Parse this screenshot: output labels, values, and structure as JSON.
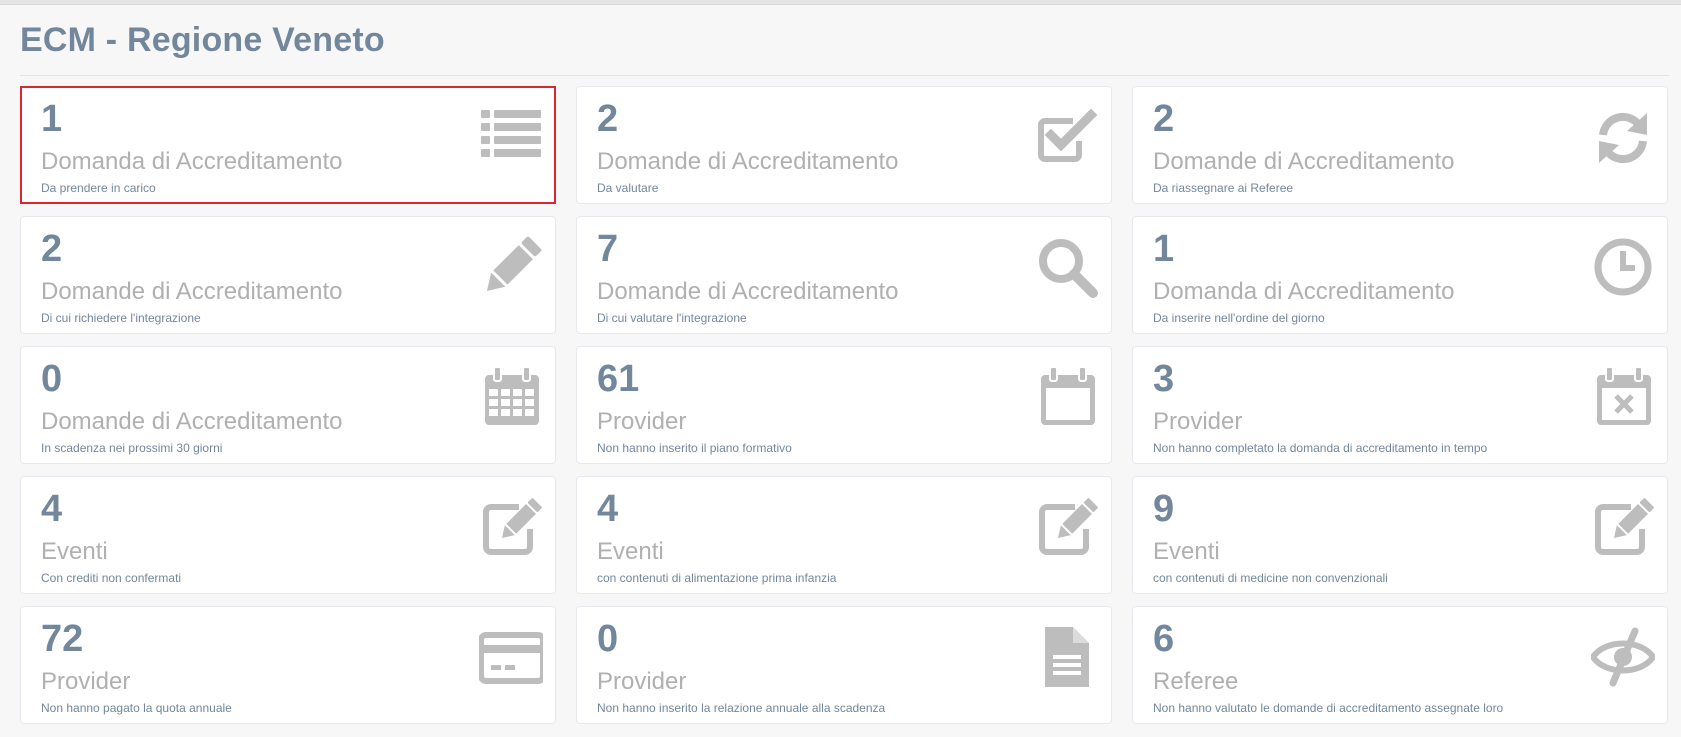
{
  "header": {
    "title": "ECM - Regione Veneto"
  },
  "colors": {
    "accent": "#73879c",
    "label": "#b0b0b0",
    "icon": "#bdbdbd",
    "selected_border": "#d9272e"
  },
  "tiles": [
    {
      "count": "1",
      "label": "Domanda di Accreditamento",
      "sub": "Da prendere in carico",
      "icon": "list-icon",
      "selected": true
    },
    {
      "count": "2",
      "label": "Domande di Accreditamento",
      "sub": "Da valutare",
      "icon": "check-square-icon"
    },
    {
      "count": "2",
      "label": "Domande di Accreditamento",
      "sub": "Da riassegnare ai Referee",
      "icon": "refresh-icon"
    },
    {
      "count": "2",
      "label": "Domande di Accreditamento",
      "sub": "Di cui richiedere l'integrazione",
      "icon": "pencil-icon"
    },
    {
      "count": "7",
      "label": "Domande di Accreditamento",
      "sub": "Di cui valutare l'integrazione",
      "icon": "search-icon"
    },
    {
      "count": "1",
      "label": "Domanda di Accreditamento",
      "sub": "Da inserire nell'ordine del giorno",
      "icon": "clock-icon"
    },
    {
      "count": "0",
      "label": "Domande di Accreditamento",
      "sub": "In scadenza nei prossimi 30 giorni",
      "icon": "calendar-grid-icon"
    },
    {
      "count": "61",
      "label": "Provider",
      "sub": "Non hanno inserito il piano formativo",
      "icon": "calendar-blank-icon"
    },
    {
      "count": "3",
      "label": "Provider",
      "sub": "Non hanno completato la domanda di accreditamento in tempo",
      "icon": "calendar-x-icon"
    },
    {
      "count": "4",
      "label": "Eventi",
      "sub": "Con crediti non confermati",
      "icon": "edit-square-icon"
    },
    {
      "count": "4",
      "label": "Eventi",
      "sub": "con contenuti di alimentazione prima infanzia",
      "icon": "edit-square-icon"
    },
    {
      "count": "9",
      "label": "Eventi",
      "sub": "con contenuti di medicine non convenzionali",
      "icon": "edit-square-icon"
    },
    {
      "count": "72",
      "label": "Provider",
      "sub": "Non hanno pagato la quota annuale",
      "icon": "credit-card-icon"
    },
    {
      "count": "0",
      "label": "Provider",
      "sub": "Non hanno inserito la relazione annuale alla scadenza",
      "icon": "document-icon"
    },
    {
      "count": "6",
      "label": "Referee",
      "sub": "Non hanno valutato le domande di accreditamento assegnate loro",
      "icon": "eye-slash-icon"
    }
  ]
}
